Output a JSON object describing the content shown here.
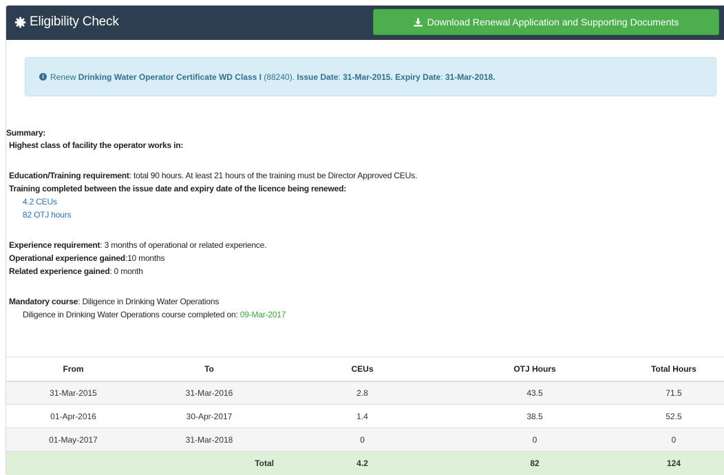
{
  "header": {
    "title": "Eligibility Check",
    "download_label": "Download Renewal Application and Supporting Documents"
  },
  "alert": {
    "prefix": "Renew",
    "certificate": "Drinking Water Operator Certificate WD Class I",
    "cert_id": "(88240).",
    "issue_label": "Issue Date",
    "issue_date": "31-Mar-2015.",
    "expiry_label": "Expiry Date",
    "expiry_date": "31-Mar-2018."
  },
  "summary": {
    "heading": "Summary:",
    "highest_class": "Highest class of facility the operator works in:",
    "edu_label": "Education/Training requirement",
    "edu_text": ": total 90 hours. At least 21 hours of the training must be Director Approved CEUs.",
    "training_completed": "Training completed between the issue date and expiry date of the licence being renewed:",
    "ceus_link": "4.2 CEUs",
    "otj_link": "82 OTJ hours",
    "exp_label": "Experience requirement",
    "exp_text": ": 3 months of operational or related experience.",
    "op_label": "Operational experience gained",
    "op_text": ":10 months",
    "rel_label": "Related experience gained",
    "rel_text": ": 0 month",
    "mand_label": "Mandatory course",
    "mand_text": ": Diligence in Drinking Water Operations",
    "course_text": "Diligence in Drinking Water Operations course completed on:",
    "course_date": "09-Mar-2017"
  },
  "table": {
    "headers": [
      "From",
      "To",
      "CEUs",
      "OTJ Hours",
      "Total Hours"
    ],
    "rows": [
      [
        "31-Mar-2015",
        "31-Mar-2016",
        "2.8",
        "43.5",
        "71.5"
      ],
      [
        "01-Apr-2016",
        "30-Apr-2017",
        "1.4",
        "38.5",
        "52.5"
      ],
      [
        "01-May-2017",
        "31-Mar-2018",
        "0",
        "0",
        "0"
      ]
    ],
    "total": [
      "",
      "Total",
      "4.2",
      "82",
      "124"
    ]
  },
  "colors": {
    "header_bg": "#2c3e50",
    "button_green": "#4cae4c",
    "alert_bg": "#d9edf7",
    "alert_text": "#31708f",
    "total_row_bg": "#dff0d8",
    "link_blue": "#2a6fb5",
    "date_green": "#3aa33a"
  },
  "icons": {
    "header": "gear-icon",
    "button": "download-icon",
    "alert": "info-icon"
  }
}
